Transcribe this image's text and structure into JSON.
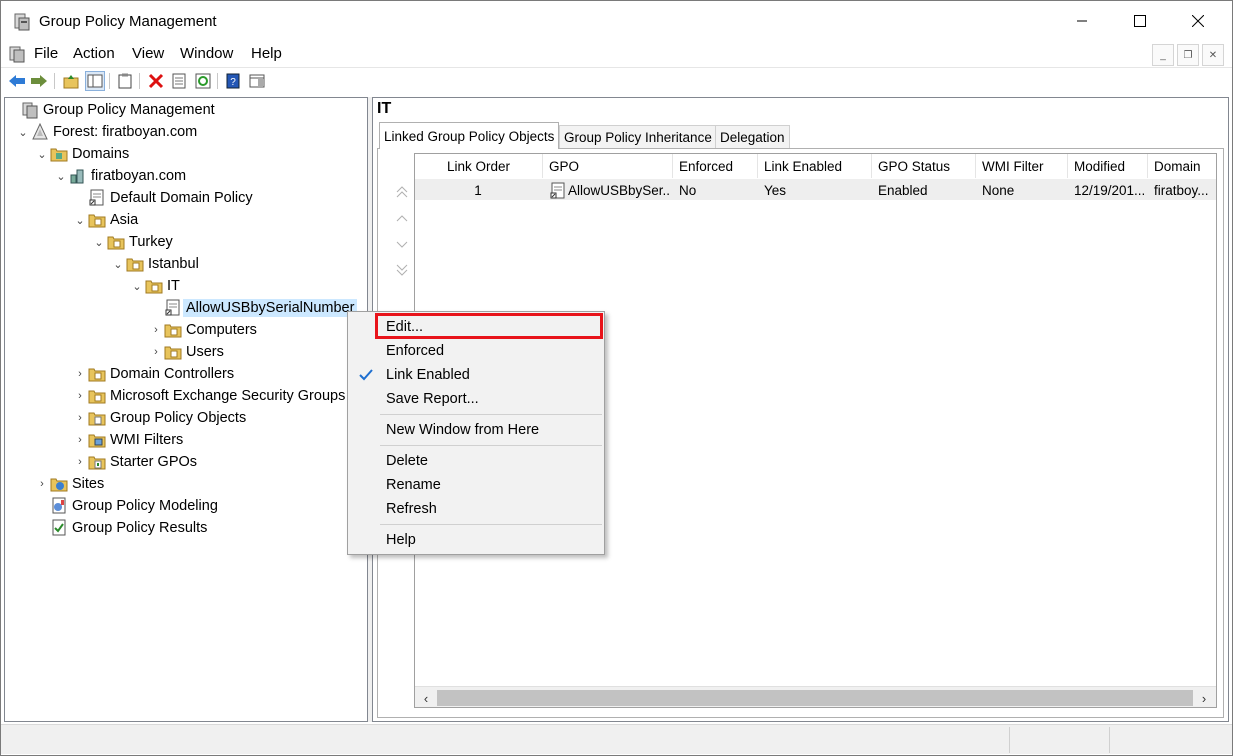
{
  "window": {
    "title": "Group Policy Management"
  },
  "menu": [
    "File",
    "Action",
    "View",
    "Window",
    "Help"
  ],
  "tree": [
    {
      "label": "Group Policy Management",
      "icon": "gpm-icon",
      "expander": ""
    },
    {
      "label": "Forest: firatboyan.com",
      "icon": "forest-icon",
      "expander": "collapse"
    },
    {
      "label": "Domains",
      "icon": "domains-folder-icon",
      "expander": "collapse"
    },
    {
      "label": "firatboyan.com",
      "icon": "domain-icon",
      "expander": "collapse"
    },
    {
      "label": "Default Domain Policy",
      "icon": "gpo-link-icon",
      "expander": ""
    },
    {
      "label": "Asia",
      "icon": "ou-folder-icon",
      "expander": "collapse"
    },
    {
      "label": "Turkey",
      "icon": "ou-folder-icon",
      "expander": "collapse"
    },
    {
      "label": "Istanbul",
      "icon": "ou-folder-icon",
      "expander": "collapse"
    },
    {
      "label": "IT",
      "icon": "ou-folder-icon",
      "expander": "collapse"
    },
    {
      "label": "AllowUSBbySerialNumber",
      "icon": "gpo-link-icon",
      "expander": ""
    },
    {
      "label": "Computers",
      "icon": "ou-folder-icon",
      "expander": "expand"
    },
    {
      "label": "Users",
      "icon": "ou-folder-icon",
      "expander": "expand"
    },
    {
      "label": "Domain Controllers",
      "icon": "ou-folder-icon",
      "expander": "expand"
    },
    {
      "label": "Microsoft Exchange Security Groups",
      "icon": "ou-folder-icon",
      "expander": "expand"
    },
    {
      "label": "Group Policy Objects",
      "icon": "gpo-folder-icon",
      "expander": "expand"
    },
    {
      "label": "WMI Filters",
      "icon": "wmi-folder-icon",
      "expander": "expand"
    },
    {
      "label": "Starter GPOs",
      "icon": "starter-folder-icon",
      "expander": "expand"
    },
    {
      "label": "Sites",
      "icon": "sites-icon",
      "expander": "expand"
    },
    {
      "label": "Group Policy Modeling",
      "icon": "modeling-icon",
      "expander": ""
    },
    {
      "label": "Group Policy Results",
      "icon": "results-icon",
      "expander": ""
    }
  ],
  "right_pane": {
    "title": "IT",
    "tabs": [
      "Linked Group Policy Objects",
      "Group Policy Inheritance",
      "Delegation"
    ],
    "columns": [
      "Link Order",
      "GPO",
      "Enforced",
      "Link Enabled",
      "GPO Status",
      "WMI Filter",
      "Modified",
      "Domain"
    ],
    "rows": [
      [
        "1",
        "AllowUSBbySer...",
        "No",
        "Yes",
        "Enabled",
        "None",
        "12/19/201...",
        "firatboy..."
      ]
    ]
  },
  "context_menu": {
    "items": [
      {
        "label": "Edit...",
        "checked": false
      },
      {
        "label": "Enforced",
        "checked": false
      },
      {
        "label": "Link Enabled",
        "checked": true
      },
      {
        "label": "Save Report...",
        "checked": false
      },
      {
        "label": "New Window from Here",
        "checked": false
      },
      {
        "label": "Delete",
        "checked": false
      },
      {
        "label": "Rename",
        "checked": false
      },
      {
        "label": "Refresh",
        "checked": false
      },
      {
        "label": "Help",
        "checked": false
      }
    ],
    "highlighted": "Edit...",
    "highlight_color": "#e8141b"
  },
  "colors": {
    "selection": "#cce8ff",
    "check": "#1e6fd0",
    "folder": "#e8c45c"
  }
}
